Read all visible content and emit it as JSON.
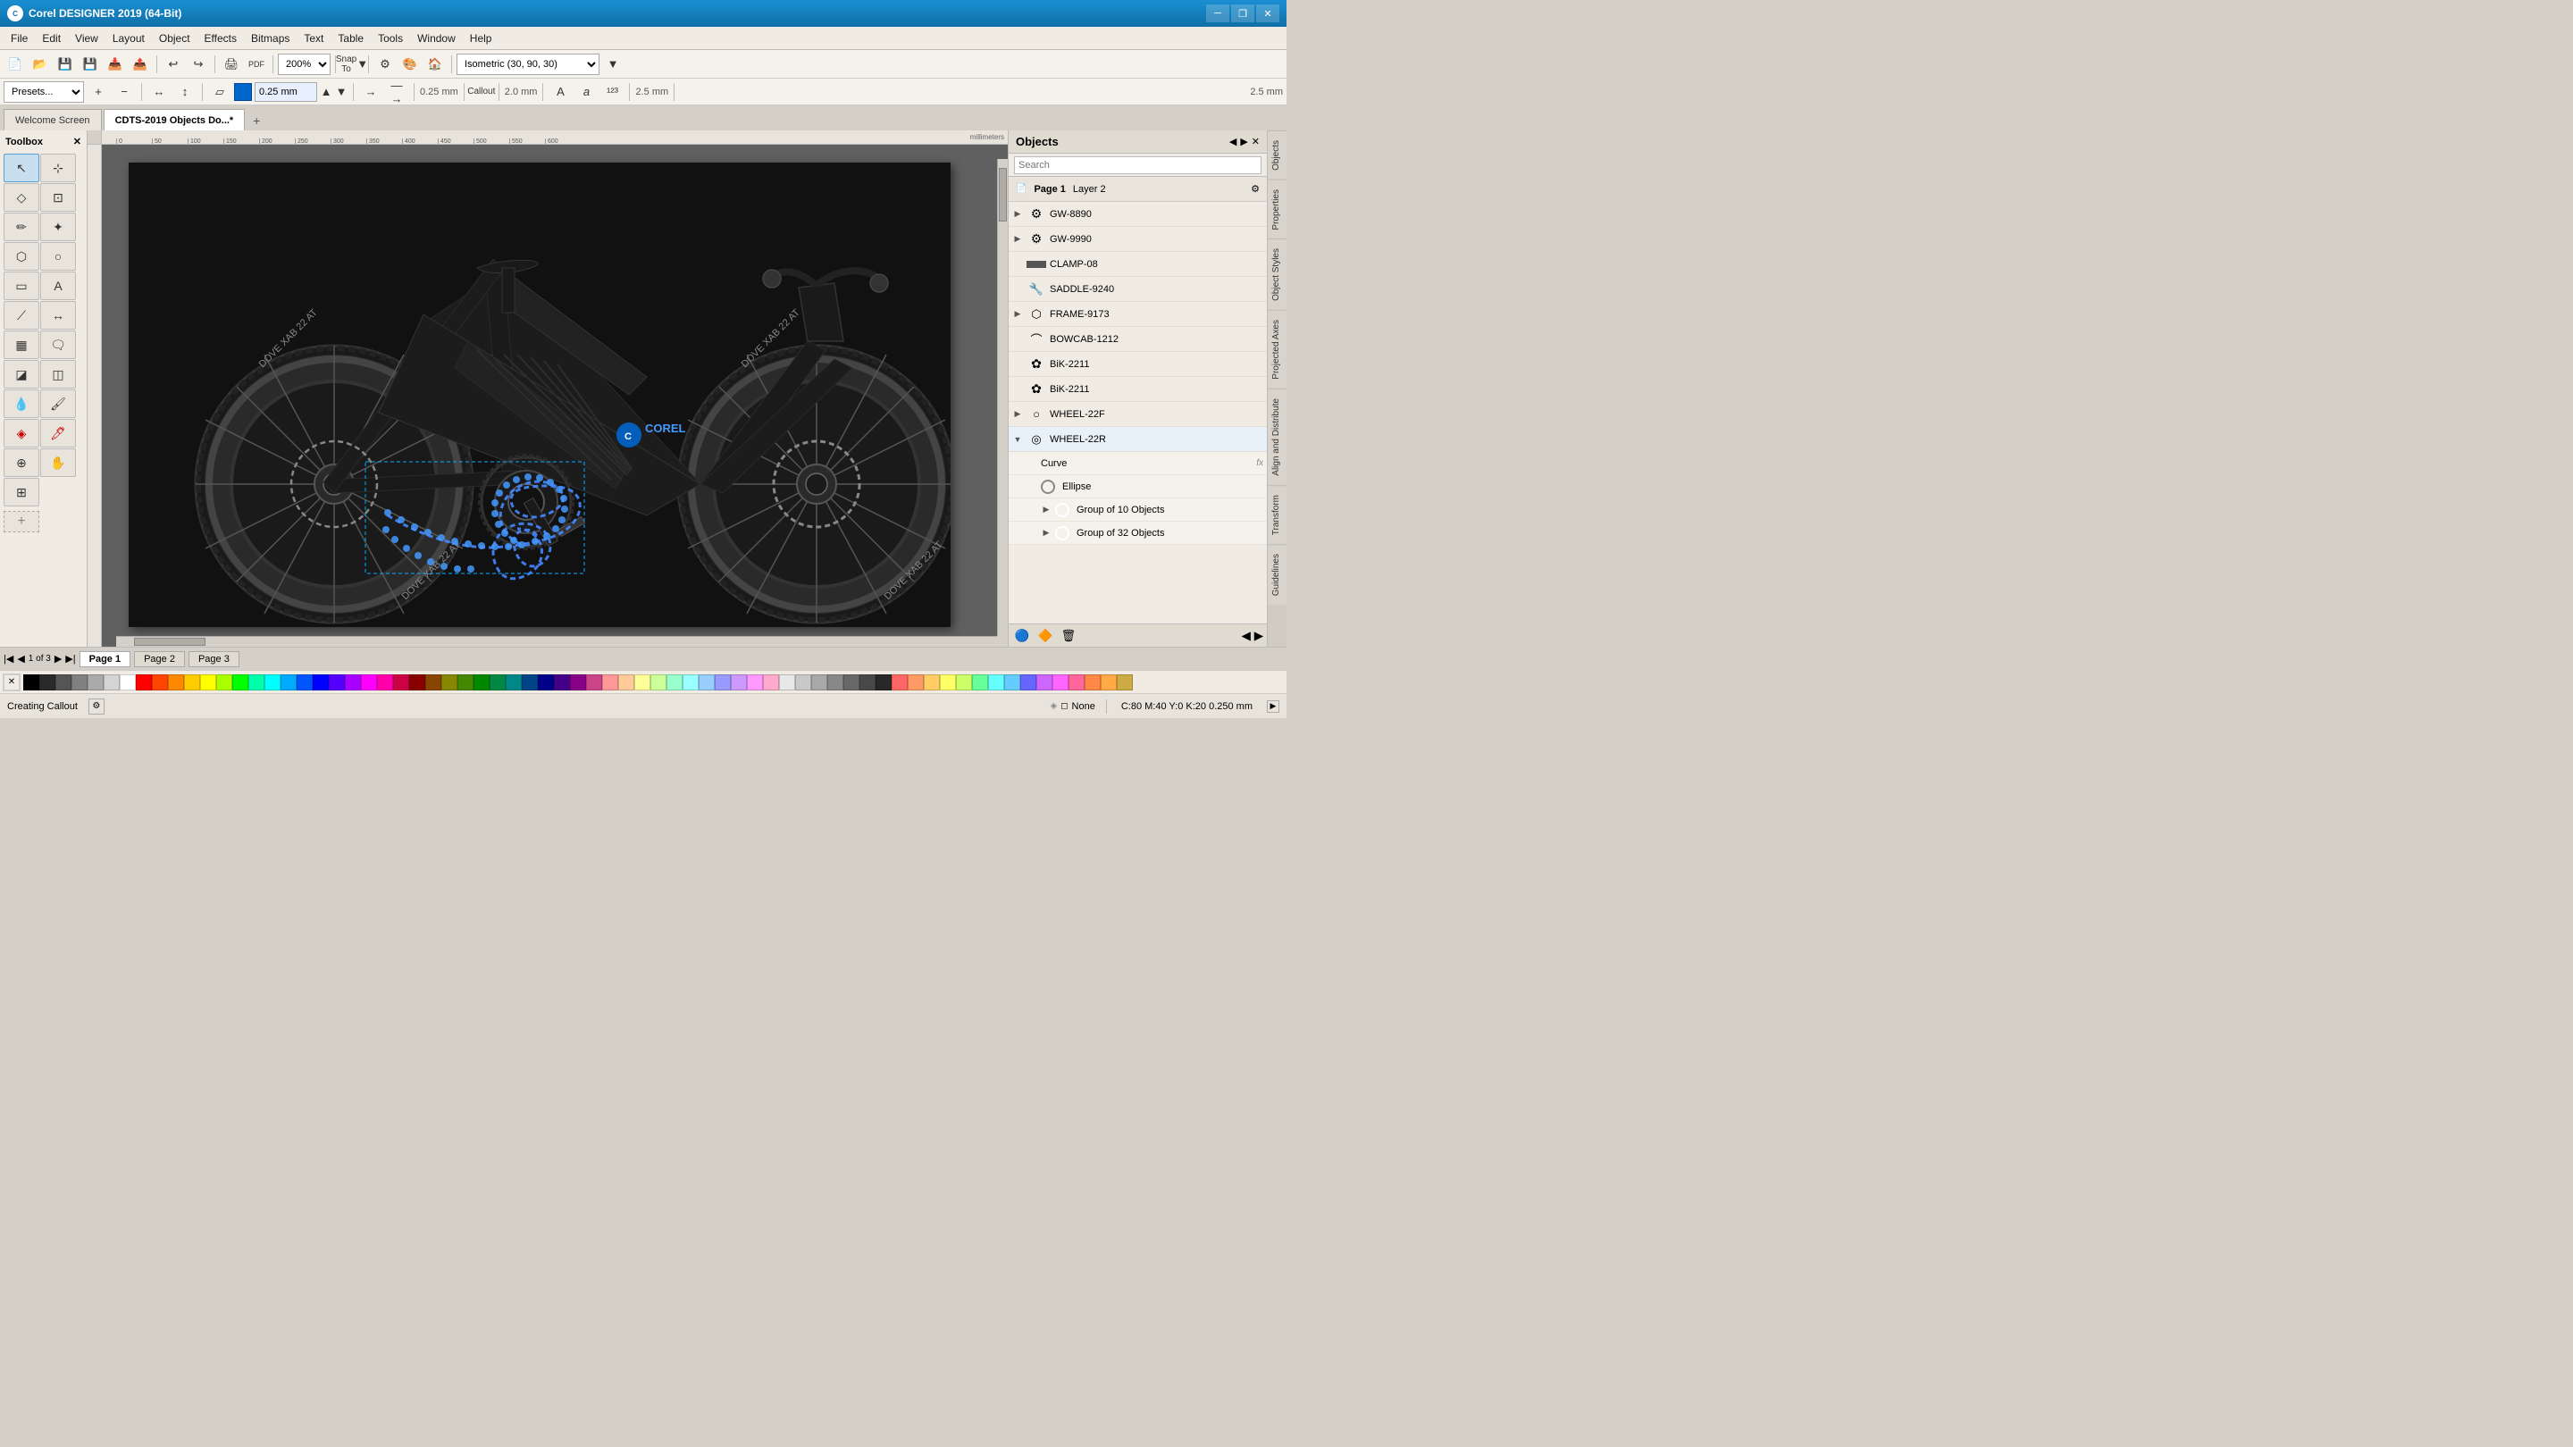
{
  "app": {
    "title": "Corel DESIGNER 2019 (64-Bit)",
    "logo": "C"
  },
  "titlebar": {
    "minimize": "─",
    "restore": "❐",
    "close": "✕"
  },
  "menu": {
    "items": [
      "File",
      "Edit",
      "View",
      "Layout",
      "Object",
      "Effects",
      "Bitmaps",
      "Text",
      "Table",
      "Tools",
      "Window",
      "Help"
    ]
  },
  "toolbar1": {
    "zoom_value": "200%",
    "snap_to": "Snap To",
    "launch": "Launch",
    "view_preset": "Isometric (30, 90, 30)"
  },
  "toolbar2": {
    "presets": "Presets...",
    "line_width": "0.25 mm",
    "callout": "Callout",
    "line_scale": "2.0 mm",
    "dimension_value": "0.25 mm",
    "page_number": "2.5 mm"
  },
  "tabs": {
    "welcome": "Welcome Screen",
    "document": "CDTS-2019 Objects Do...*",
    "add_tab": "+"
  },
  "toolbox": {
    "title": "Toolbox",
    "tools": [
      {
        "id": "pick",
        "icon": "↖",
        "label": "Pick Tool"
      },
      {
        "id": "shape",
        "icon": "⬡",
        "label": "Shape Tool"
      },
      {
        "id": "freehand",
        "icon": "✏",
        "label": "Freehand"
      },
      {
        "id": "crop",
        "icon": "⊞",
        "label": "Crop"
      },
      {
        "id": "zoom",
        "icon": "⌕",
        "label": "Zoom"
      },
      {
        "id": "curves",
        "icon": "⌒",
        "label": "Curves"
      },
      {
        "id": "rectangle",
        "icon": "▭",
        "label": "Rectangle"
      },
      {
        "id": "ellipse",
        "icon": "○",
        "label": "Ellipse"
      },
      {
        "id": "polygon",
        "icon": "⬠",
        "label": "Polygon"
      },
      {
        "id": "text",
        "icon": "A",
        "label": "Text"
      },
      {
        "id": "table",
        "icon": "▦",
        "label": "Table"
      },
      {
        "id": "dimension",
        "icon": "↔",
        "label": "Dimension"
      },
      {
        "id": "connector",
        "icon": "⟋",
        "label": "Connector"
      },
      {
        "id": "shadow",
        "icon": "◪",
        "label": "Shadow"
      },
      {
        "id": "color_eye",
        "icon": "◎",
        "label": "Color Eye"
      },
      {
        "id": "paint",
        "icon": "🖌",
        "label": "Paint Bucket"
      },
      {
        "id": "eyedropper",
        "icon": "💧",
        "label": "Eyedropper"
      },
      {
        "id": "hand",
        "icon": "✋",
        "label": "Pan"
      },
      {
        "id": "interactive",
        "icon": "☩",
        "label": "Interactive"
      }
    ]
  },
  "objects_panel": {
    "title": "Objects",
    "search_placeholder": "Search",
    "layer_label": "Page 1",
    "layer_sublabel": "Layer 2",
    "items": [
      {
        "id": "GW-8890",
        "label": "GW-8890",
        "type": "gear",
        "expandable": true,
        "indent": 0
      },
      {
        "id": "GW-9990",
        "label": "GW-9990",
        "type": "gear",
        "expandable": true,
        "indent": 0
      },
      {
        "id": "CLAMP-08",
        "label": "CLAMP-08",
        "type": "rect",
        "expandable": false,
        "indent": 0
      },
      {
        "id": "SADDLE-9240",
        "label": "SADDLE-9240",
        "type": "tool",
        "expandable": false,
        "indent": 0
      },
      {
        "id": "FRAME-9173",
        "label": "FRAME-9173",
        "type": "shape",
        "expandable": true,
        "indent": 0
      },
      {
        "id": "BOWCAB-1212",
        "label": "BOWCAB-1212",
        "type": "curve",
        "expandable": false,
        "indent": 0
      },
      {
        "id": "BiK-2211a",
        "label": "BiK-2211",
        "type": "gear2",
        "expandable": false,
        "indent": 0
      },
      {
        "id": "BiK-2211b",
        "label": "BiK-2211",
        "type": "gear2",
        "expandable": false,
        "indent": 0
      },
      {
        "id": "WHEEL-22F",
        "label": "WHEEL-22F",
        "type": "wheel",
        "expandable": true,
        "indent": 0
      },
      {
        "id": "WHEEL-22R",
        "label": "WHEEL-22R",
        "type": "wheel",
        "expandable": true,
        "indent": 0,
        "expanded": true
      },
      {
        "id": "Curve",
        "label": "Curve",
        "type": "sub",
        "indent": 1,
        "fx": "fx"
      },
      {
        "id": "Ellipse",
        "label": "Ellipse",
        "type": "ellipse_sub",
        "indent": 1
      },
      {
        "id": "Group10",
        "label": "Group of 10 Objects",
        "type": "group",
        "expandable": true,
        "indent": 1
      },
      {
        "id": "Group32",
        "label": "Group of 32 Objects",
        "type": "group",
        "expandable": true,
        "indent": 1
      }
    ]
  },
  "side_tabs": [
    "Objects",
    "Properties",
    "Object Styles",
    "Projected Axes",
    "Align and Distribute",
    "Transform",
    "Guidelines"
  ],
  "pages": {
    "current": "Page 1",
    "total": 3,
    "list": [
      "Page 1",
      "Page 2",
      "Page 3"
    ]
  },
  "status": {
    "action": "Creating Callout",
    "fill_label": "None",
    "color_info": "C:80 M:40 Y:0 K:20  0.250 mm"
  },
  "palette_colors": [
    "#000000",
    "#2a2a2a",
    "#555555",
    "#808080",
    "#aaaaaa",
    "#d4d4d4",
    "#ffffff",
    "#ff0000",
    "#ff4400",
    "#ff8800",
    "#ffcc00",
    "#ffff00",
    "#aaff00",
    "#00ff00",
    "#00ffaa",
    "#00ffff",
    "#00aaff",
    "#0055ff",
    "#0000ff",
    "#5500ff",
    "#aa00ff",
    "#ff00ff",
    "#ff00aa",
    "#cc0044",
    "#880000",
    "#884400",
    "#888800",
    "#448800",
    "#008800",
    "#008844",
    "#008888",
    "#004488",
    "#000088",
    "#440088",
    "#880088",
    "#cc4488",
    "#ff9999",
    "#ffcc99",
    "#ffff99",
    "#ccff99",
    "#99ffcc",
    "#99ffff",
    "#99ccff",
    "#9999ff",
    "#cc99ff",
    "#ff99ff",
    "#ffaacc",
    "#e8e8e8",
    "#c8c8c8",
    "#a8a8a8",
    "#888888",
    "#686868",
    "#484848",
    "#282828",
    "#ff6666",
    "#ff9966",
    "#ffcc66",
    "#ffff66",
    "#ccff66",
    "#66ff99",
    "#66ffff",
    "#66ccff",
    "#6666ff",
    "#cc66ff",
    "#ff66ff",
    "#ff6699",
    "#ff8844",
    "#ffaa44",
    "#ccaa44"
  ]
}
